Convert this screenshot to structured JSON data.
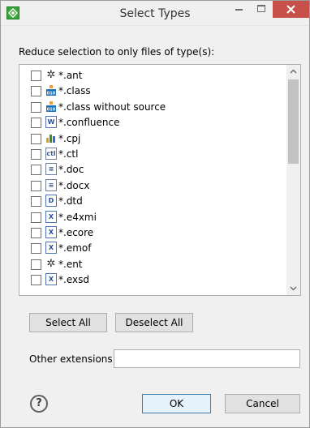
{
  "window": {
    "title": "Select Types"
  },
  "instruction": "Reduce selection to only files of type(s):",
  "file_types": [
    {
      "label": "*.ant",
      "icon": "ant-icon",
      "glyph": "✲"
    },
    {
      "label": "*.class",
      "icon": "class-file-icon",
      "glyph": "010"
    },
    {
      "label": "*.class without source",
      "icon": "class-file-icon",
      "glyph": "010"
    },
    {
      "label": "*.confluence",
      "icon": "wiki-icon",
      "glyph": "W"
    },
    {
      "label": "*.cpj",
      "icon": "bar-chart-icon",
      "glyph": ""
    },
    {
      "label": "*.ctl",
      "icon": "ctl-file-icon",
      "glyph": "ctl"
    },
    {
      "label": "*.doc",
      "icon": "text-doc-icon",
      "glyph": "≡"
    },
    {
      "label": "*.docx",
      "icon": "text-doc-icon",
      "glyph": "≡"
    },
    {
      "label": "*.dtd",
      "icon": "dtd-icon",
      "glyph": "D"
    },
    {
      "label": "*.e4xmi",
      "icon": "xml-icon",
      "glyph": "X"
    },
    {
      "label": "*.ecore",
      "icon": "xml-icon",
      "glyph": "X"
    },
    {
      "label": "*.emof",
      "icon": "xml-icon",
      "glyph": "X"
    },
    {
      "label": "*.ent",
      "icon": "ant-icon",
      "glyph": "✲"
    },
    {
      "label": "*.exsd",
      "icon": "xml-icon",
      "glyph": "X"
    }
  ],
  "buttons": {
    "select_all": "Select All",
    "deselect_all": "Deselect All",
    "ok": "OK",
    "cancel": "Cancel"
  },
  "other_extensions": {
    "label": "Other extensions:",
    "value": ""
  },
  "help_glyph": "?",
  "colors": {
    "close_button": "#c7504a",
    "app_icon": "#3aa63a",
    "default_button_border": "#3c7fb1"
  }
}
